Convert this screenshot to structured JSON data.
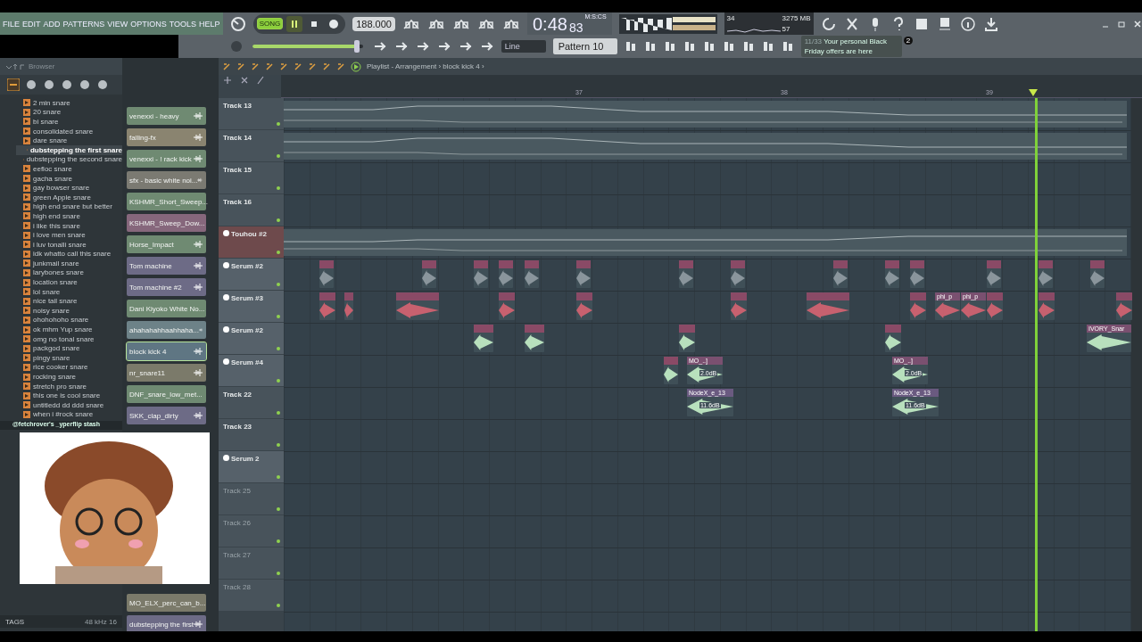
{
  "menu": [
    "FILE",
    "EDIT",
    "ADD",
    "PATTERNS",
    "VIEW",
    "OPTIONS",
    "TOOLS",
    "HELP"
  ],
  "transport": {
    "mode_label": "SONG",
    "song_mode": true,
    "playing": true,
    "tempo": "188.000",
    "time": "0:48",
    "time_cs": "83",
    "time_unit": "M:S:CS",
    "snap": "Line",
    "pattern": "Pattern 10",
    "master_volume": {
      "level": 0.95
    }
  },
  "cpu": {
    "cpu": "34",
    "memory": "3275 MB",
    "polyphony": "57"
  },
  "news": {
    "counter": "11/33",
    "text": "Your personal Black Friday offers are here",
    "badge": "2"
  },
  "browser": {
    "title": "Browser",
    "items": [
      {
        "label": "2 min snare",
        "selected": false
      },
      {
        "label": "20 snare",
        "selected": false
      },
      {
        "label": "bi snare",
        "selected": false
      },
      {
        "label": "consolidated snare",
        "selected": false
      },
      {
        "label": "dare snare",
        "selected": false
      },
      {
        "label": "dubstepping the first snare",
        "selected": true
      },
      {
        "label": "dubstepping the second snare",
        "selected": false
      },
      {
        "label": "eefloc snare",
        "selected": false
      },
      {
        "label": "gacha snare",
        "selected": false
      },
      {
        "label": "gay bowser snare",
        "selected": false
      },
      {
        "label": "green Apple snare",
        "selected": false
      },
      {
        "label": "high end snare but better",
        "selected": false
      },
      {
        "label": "high end snare",
        "selected": false
      },
      {
        "label": "i like this snare",
        "selected": false
      },
      {
        "label": "i love men snare",
        "selected": false
      },
      {
        "label": "i luv tonalli snare",
        "selected": false
      },
      {
        "label": "idk whatto call this snare",
        "selected": false
      },
      {
        "label": "junkmail snare",
        "selected": false
      },
      {
        "label": "larybones snare",
        "selected": false
      },
      {
        "label": "location snare",
        "selected": false
      },
      {
        "label": "lol snare",
        "selected": false
      },
      {
        "label": "nice tail snare",
        "selected": false
      },
      {
        "label": "noisy snare",
        "selected": false
      },
      {
        "label": "ohohohoho snare",
        "selected": false
      },
      {
        "label": "ok mhm Yup snare",
        "selected": false
      },
      {
        "label": "omg no tonal snare",
        "selected": false
      },
      {
        "label": "packgod snare",
        "selected": false
      },
      {
        "label": "pingy snare",
        "selected": false
      },
      {
        "label": "rice cooker snare",
        "selected": false
      },
      {
        "label": "rocking snare",
        "selected": false
      },
      {
        "label": "stretch pro snare",
        "selected": false
      },
      {
        "label": "this one is cool snare",
        "selected": false
      },
      {
        "label": "untitledd dd ddd snare",
        "selected": false
      },
      {
        "label": "when i #rock snare",
        "selected": false
      }
    ],
    "folder": "@fetchrover's _yperflip stash",
    "sample_info": "48 kHz 16",
    "tags": "TAGS"
  },
  "channels": {
    "top": [
      {
        "label": "venexxi - heavy",
        "color": "#6f8a72",
        "selected": false
      },
      {
        "label": "falling-fx",
        "color": "#8a8470",
        "selected": false
      },
      {
        "label": "venexxi - ! rack kick",
        "color": "#6f8a72",
        "selected": false
      },
      {
        "label": "sfx - basic white noi...",
        "color": "#7b7a72",
        "selected": false
      },
      {
        "label": "KSHMR_Short_Sweep...",
        "color": "#6f8a72",
        "selected": false
      },
      {
        "label": "KSHMR_Sweep_Dow...",
        "color": "#86677c",
        "selected": false
      },
      {
        "label": "Horse_Impact",
        "color": "#6f8a72",
        "selected": false
      },
      {
        "label": "Tom machine",
        "color": "#6d6b86",
        "selected": false
      },
      {
        "label": "Tom machine #2",
        "color": "#6d6b86",
        "selected": false
      },
      {
        "label": "Dani Kiyoko White No...",
        "color": "#6f8a72",
        "selected": false
      },
      {
        "label": "ahahahahhaahhaha...",
        "color": "#6d8288",
        "selected": false
      },
      {
        "label": "block kick 4",
        "color": "#5f7683",
        "selected": true
      },
      {
        "label": "nr_snare11",
        "color": "#7b7a6a",
        "selected": false
      },
      {
        "label": "DNF_snare_low_met...",
        "color": "#6f8a72",
        "selected": false
      },
      {
        "label": "SKK_clap_dirty",
        "color": "#6d6b86",
        "selected": false
      }
    ],
    "bottom": [
      {
        "label": "MO_ELX_perc_can_b...",
        "color": "#7b7a6a",
        "selected": false
      },
      {
        "label": "dubstepping the first",
        "color": "#6d6b86",
        "selected": false
      }
    ]
  },
  "playlist": {
    "title": "Playlist - Arrangement › block kick 4 ›",
    "ruler": [
      "37",
      "38",
      "39"
    ],
    "tracks": [
      {
        "name": "Track 13",
        "kind": "empty",
        "color": "#48535b"
      },
      {
        "name": "Track 14",
        "kind": "empty",
        "color": "#48535b"
      },
      {
        "name": "Track 15",
        "kind": "empty",
        "color": "#48535b"
      },
      {
        "name": "Track 16",
        "kind": "empty",
        "color": "#48535b"
      },
      {
        "name": "Touhou #2",
        "kind": "named",
        "color": "#6e4a4c"
      },
      {
        "name": "Serum #2",
        "kind": "named",
        "color": "#56616a"
      },
      {
        "name": "Serum #3",
        "kind": "named",
        "color": "#56616a",
        "clips": [
          {
            "label": "phi_p"
          },
          {
            "label": "phi_p"
          }
        ]
      },
      {
        "name": "Serum #2",
        "kind": "named",
        "color": "#56616a",
        "clips": [
          {
            "label": "IVORY_Snar"
          }
        ]
      },
      {
        "name": "Serum #4",
        "kind": "named",
        "color": "#56616a",
        "clips": [
          {
            "label": "MO_..]",
            "gain": "2.0dB"
          },
          {
            "label": "MO_..]",
            "gain": "2.0dB"
          }
        ]
      },
      {
        "name": "Track 22",
        "kind": "empty",
        "color": "#48535b",
        "clips": [
          {
            "label": "NodeX_e_13",
            "gain": "11.6dB"
          },
          {
            "label": "NodeX_e_13",
            "gain": "11.6dB"
          }
        ]
      },
      {
        "name": "Track 23",
        "kind": "empty",
        "color": "#48535b"
      },
      {
        "name": "Serum 2",
        "kind": "named",
        "color": "#56616a"
      },
      {
        "name": "Track 25",
        "kind": "unused",
        "color": "#48535b"
      },
      {
        "name": "Track 26",
        "kind": "unused",
        "color": "#48535b"
      },
      {
        "name": "Track 27",
        "kind": "unused",
        "color": "#48535b"
      },
      {
        "name": "Track 28",
        "kind": "unused",
        "color": "#48535b"
      }
    ]
  }
}
